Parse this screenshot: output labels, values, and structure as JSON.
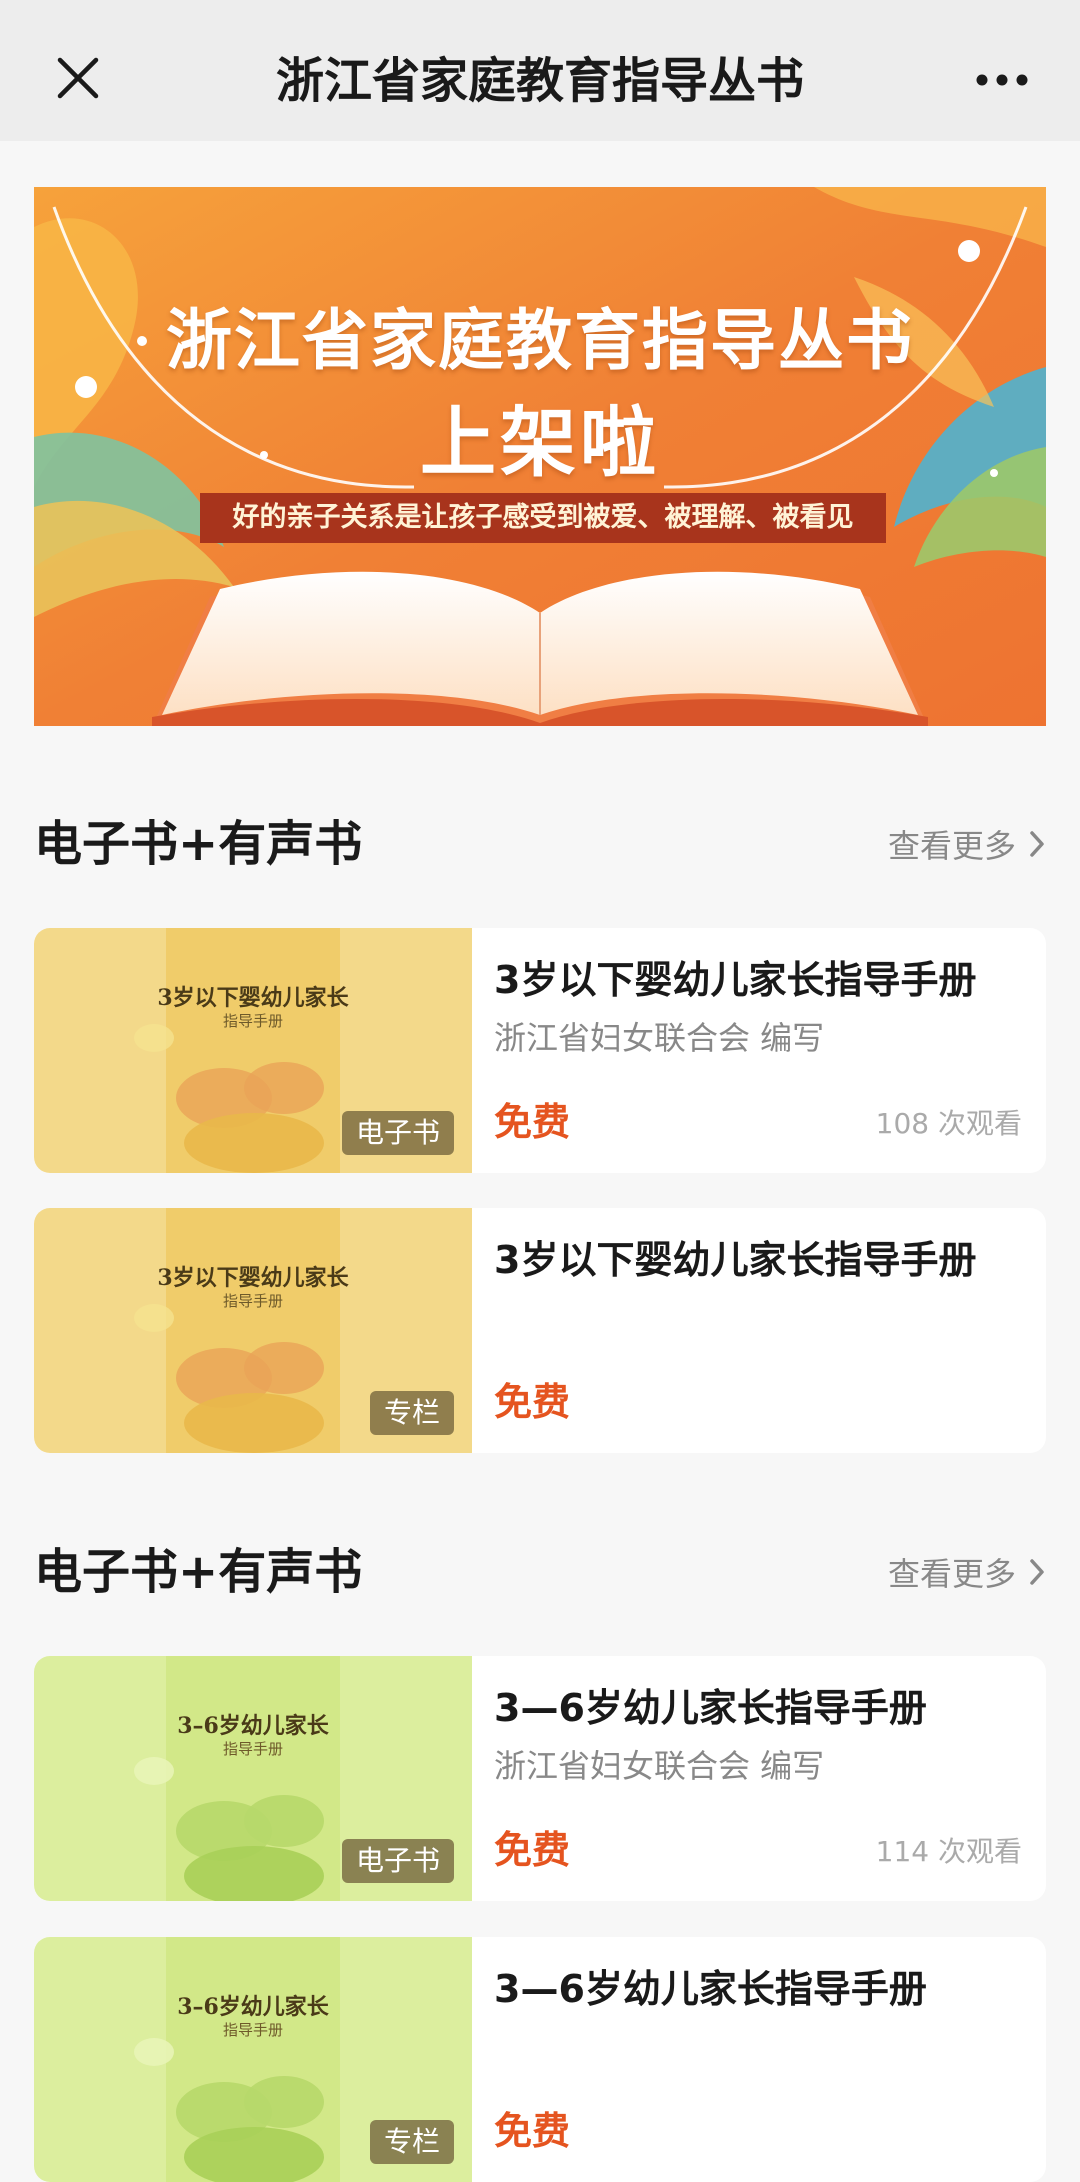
{
  "nav": {
    "title": "浙江省家庭教育指导丛书"
  },
  "banner": {
    "title": "浙江省家庭教育指导丛书",
    "subtitle": "上架啦",
    "tagline": "好的亲子关系是让孩子感受到被爱、被理解、被看见"
  },
  "sections": [
    {
      "title": "电子书+有声书",
      "more_label": "查看更多",
      "items": [
        {
          "title": "3岁以下婴幼儿家长指导手册",
          "author": "浙江省妇女联合会 编写",
          "price": "免费",
          "views": "108 次观看",
          "badge": "电子书",
          "cover_title": "3岁以下婴幼儿家长",
          "cover_subtitle": "指导手册",
          "cover_color": "#f2d27a"
        },
        {
          "title": "3岁以下婴幼儿家长指导手册",
          "price": "免费",
          "badge": "专栏",
          "cover_title": "3岁以下婴幼儿家长",
          "cover_subtitle": "指导手册",
          "cover_color": "#f2d27a"
        }
      ]
    },
    {
      "title": "电子书+有声书",
      "more_label": "查看更多",
      "items": [
        {
          "title": "3—6岁幼儿家长指导手册",
          "author": "浙江省妇女联合会 编写",
          "price": "免费",
          "views": "114 次观看",
          "badge": "电子书",
          "cover_title": "3–6岁幼儿家长",
          "cover_subtitle": "指导手册",
          "cover_color": "#d9ec9a"
        },
        {
          "title": "3—6岁幼儿家长指导手册",
          "price": "免费",
          "badge": "专栏",
          "cover_title": "3–6岁幼儿家长",
          "cover_subtitle": "指导手册",
          "cover_color": "#d9ec9a"
        }
      ]
    }
  ],
  "colors": {
    "nav_bg": "#ededed",
    "page_bg": "#f7f7f7",
    "price": "#e5541f",
    "banner_orange": "#f07f36"
  },
  "icons": {
    "close": "close-icon",
    "more": "more-dots-icon",
    "chevron": "chevron-right-icon"
  }
}
